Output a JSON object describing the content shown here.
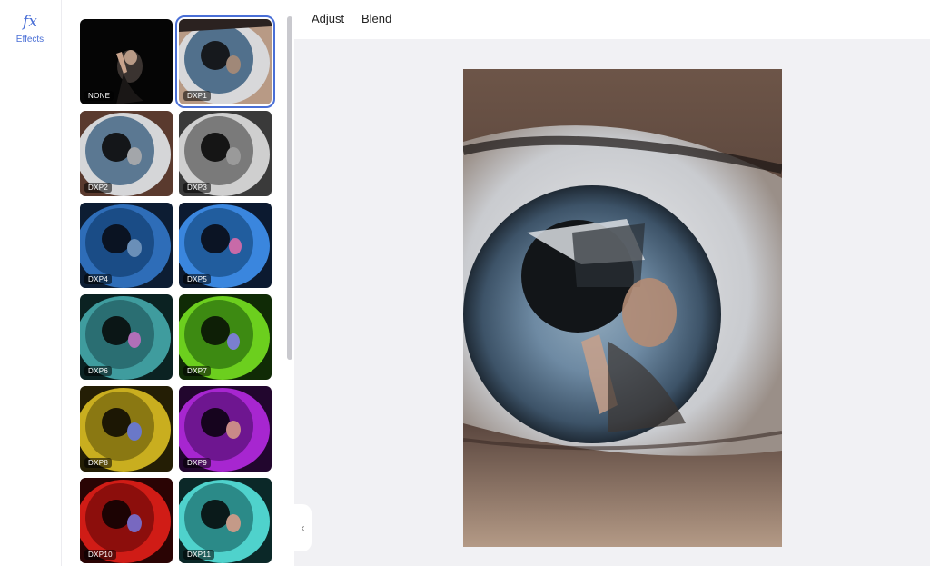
{
  "rail": {
    "items": [
      {
        "icon": "fx-icon",
        "glyph": "fx",
        "label": "Effects",
        "active": true
      }
    ]
  },
  "effects": [
    {
      "label": "NONE",
      "selected": false
    },
    {
      "label": "DXP1",
      "selected": true
    },
    {
      "label": "DXP2",
      "selected": false
    },
    {
      "label": "DXP3",
      "selected": false
    },
    {
      "label": "DXP4",
      "selected": false
    },
    {
      "label": "DXP5",
      "selected": false
    },
    {
      "label": "DXP6",
      "selected": false
    },
    {
      "label": "DXP7",
      "selected": false
    },
    {
      "label": "DXP8",
      "selected": false
    },
    {
      "label": "DXP9",
      "selected": false
    },
    {
      "label": "DXP10",
      "selected": false
    },
    {
      "label": "DXP11",
      "selected": false
    }
  ],
  "toolbar": {
    "tabs": [
      {
        "label": "Adjust"
      },
      {
        "label": "Blend"
      }
    ]
  },
  "colors": {
    "accent": "#4a6fd6",
    "canvas_bg": "#f1f1f4"
  }
}
